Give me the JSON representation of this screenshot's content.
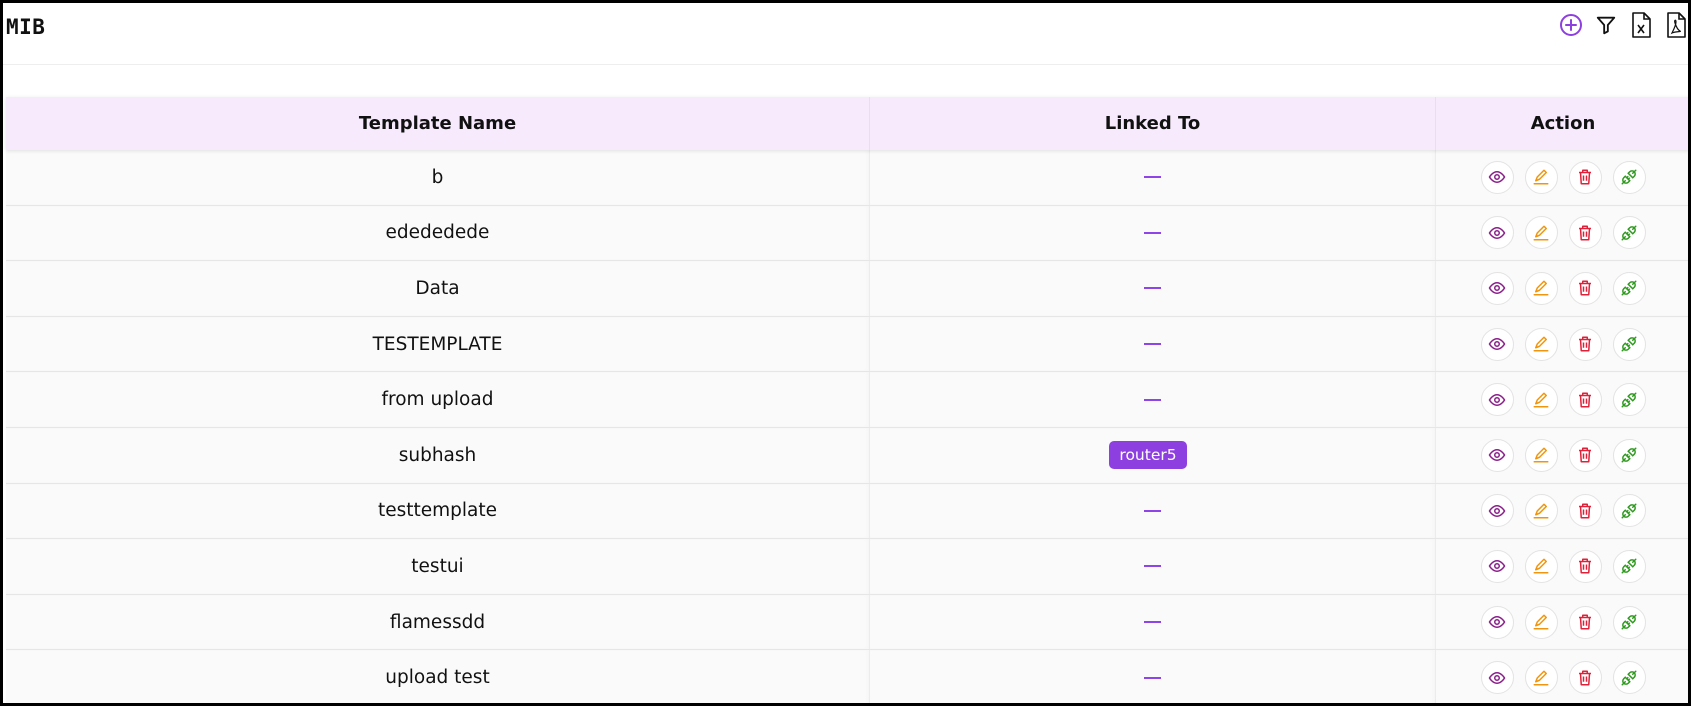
{
  "page": {
    "title": "MIB"
  },
  "toolbar": {
    "icons": [
      "add-circle-icon",
      "filter-icon",
      "excel-export-icon",
      "pdf-export-icon"
    ],
    "accent_color": "#8e3fe0"
  },
  "table": {
    "headers": [
      "Template Name",
      "Linked To",
      "Action"
    ],
    "empty_placeholder": "—",
    "rows": [
      {
        "name": "b",
        "linked": ""
      },
      {
        "name": "edededede",
        "linked": ""
      },
      {
        "name": "Data",
        "linked": ""
      },
      {
        "name": "TESTEMPLATE",
        "linked": ""
      },
      {
        "name": "from upload",
        "linked": ""
      },
      {
        "name": "subhash",
        "linked": "router5"
      },
      {
        "name": "testtemplate",
        "linked": ""
      },
      {
        "name": "testui",
        "linked": ""
      },
      {
        "name": "flamessdd",
        "linked": ""
      },
      {
        "name": "upload test",
        "linked": ""
      }
    ],
    "row_actions": [
      "view-icon",
      "edit-icon",
      "delete-icon",
      "link-icon"
    ],
    "action_colors": {
      "view": "#8a1f8a",
      "edit": "#f0960e",
      "delete": "#e0213a",
      "link": "#2e9a1e"
    }
  }
}
